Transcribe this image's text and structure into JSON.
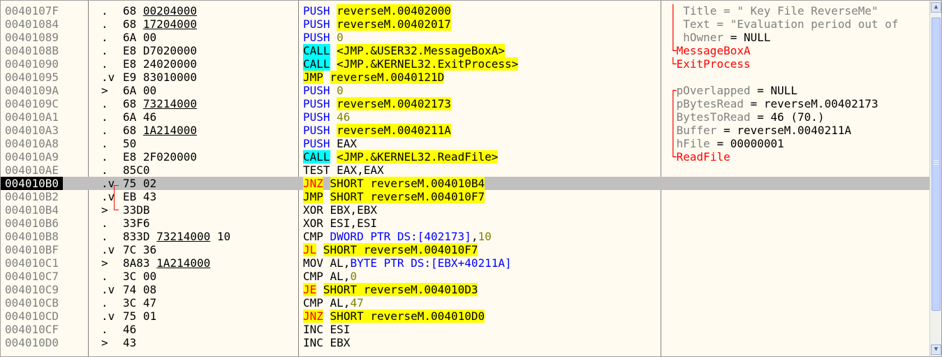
{
  "rows": [
    {
      "addr": "0040107F",
      "mark": ".",
      "hex": [
        {
          "t": "68 "
        },
        {
          "t": "00204000",
          "u": true
        }
      ],
      "dis": [
        {
          "t": "PUSH",
          "c": "kw-push"
        },
        {
          "t": " "
        },
        {
          "t": "reverseM.00402000",
          "c": "yl"
        }
      ],
      "cmt": [
        {
          "t": "│ ",
          "c": "cm-red"
        },
        {
          "t": "Title = \" Key File ReverseMe\"",
          "c": "cm-gray"
        }
      ]
    },
    {
      "addr": "00401084",
      "mark": ".",
      "hex": [
        {
          "t": "68 "
        },
        {
          "t": "17204000",
          "u": true
        }
      ],
      "dis": [
        {
          "t": "PUSH",
          "c": "kw-push"
        },
        {
          "t": " "
        },
        {
          "t": "reverseM.00402017",
          "c": "yl"
        }
      ],
      "cmt": [
        {
          "t": "│ ",
          "c": "cm-red"
        },
        {
          "t": "Text = \"Evaluation period out of",
          "c": "cm-gray"
        }
      ]
    },
    {
      "addr": "00401089",
      "mark": ".",
      "hex": [
        {
          "t": "6A 00"
        }
      ],
      "dis": [
        {
          "t": "PUSH",
          "c": "kw-push"
        },
        {
          "t": " "
        },
        {
          "t": "0",
          "c": "num"
        }
      ],
      "cmt": [
        {
          "t": "│ ",
          "c": "cm-red"
        },
        {
          "t": "hOwner",
          "c": "cm-gray"
        },
        {
          "t": " = NULL"
        }
      ]
    },
    {
      "addr": "0040108B",
      "mark": ".",
      "hex": [
        {
          "t": "E8 D7020000"
        }
      ],
      "dis": [
        {
          "t": "CALL",
          "c": "kw-call"
        },
        {
          "t": " "
        },
        {
          "t": "<JMP.&USER32.MessageBoxA>",
          "c": "yl"
        }
      ],
      "cmt": [
        {
          "t": "└",
          "c": "cm-red"
        },
        {
          "t": "MessageBoxA",
          "c": "cm-red"
        }
      ]
    },
    {
      "addr": "00401090",
      "mark": ".",
      "hex": [
        {
          "t": "E8 24020000"
        }
      ],
      "dis": [
        {
          "t": "CALL",
          "c": "kw-call"
        },
        {
          "t": " "
        },
        {
          "t": "<JMP.&KERNEL32.ExitProcess>",
          "c": "yl"
        }
      ],
      "cmt": [
        {
          "t": "└",
          "c": "cm-red"
        },
        {
          "t": "ExitProcess",
          "c": "cm-red"
        }
      ]
    },
    {
      "addr": "00401095",
      "mark": ".v",
      "hex": [
        {
          "t": "E9 83010000"
        }
      ],
      "dis": [
        {
          "t": "JMP",
          "c": "kw-jmp"
        },
        {
          "t": " "
        },
        {
          "t": "reverseM.0040121D",
          "c": "yl"
        }
      ],
      "cmt": []
    },
    {
      "addr": "0040109A",
      "mark": ">",
      "hex": [
        {
          "t": "6A 00"
        }
      ],
      "dis": [
        {
          "t": "PUSH",
          "c": "kw-push"
        },
        {
          "t": " "
        },
        {
          "t": "0",
          "c": "num"
        }
      ],
      "cmt": [
        {
          "t": "┌",
          "c": "cm-red"
        },
        {
          "t": "pOverlapped",
          "c": "cm-gray"
        },
        {
          "t": " = NULL"
        }
      ]
    },
    {
      "addr": "0040109C",
      "mark": ".",
      "hex": [
        {
          "t": "68 "
        },
        {
          "t": "73214000",
          "u": true
        }
      ],
      "dis": [
        {
          "t": "PUSH",
          "c": "kw-push"
        },
        {
          "t": " "
        },
        {
          "t": "reverseM.00402173",
          "c": "yl"
        }
      ],
      "cmt": [
        {
          "t": "│",
          "c": "cm-red"
        },
        {
          "t": "pBytesRead",
          "c": "cm-gray"
        },
        {
          "t": " = reverseM.00402173"
        }
      ]
    },
    {
      "addr": "004010A1",
      "mark": ".",
      "hex": [
        {
          "t": "6A 46"
        }
      ],
      "dis": [
        {
          "t": "PUSH",
          "c": "kw-push"
        },
        {
          "t": " "
        },
        {
          "t": "46",
          "c": "num"
        }
      ],
      "cmt": [
        {
          "t": "│",
          "c": "cm-red"
        },
        {
          "t": "BytesToRead",
          "c": "cm-gray"
        },
        {
          "t": " = 46 (70.)"
        }
      ]
    },
    {
      "addr": "004010A3",
      "mark": ".",
      "hex": [
        {
          "t": "68 "
        },
        {
          "t": "1A214000",
          "u": true
        }
      ],
      "dis": [
        {
          "t": "PUSH",
          "c": "kw-push"
        },
        {
          "t": " "
        },
        {
          "t": "reverseM.0040211A",
          "c": "yl"
        }
      ],
      "cmt": [
        {
          "t": "│",
          "c": "cm-red"
        },
        {
          "t": "Buffer",
          "c": "cm-gray"
        },
        {
          "t": " = reverseM.0040211A"
        }
      ]
    },
    {
      "addr": "004010A8",
      "mark": ".",
      "hex": [
        {
          "t": "50"
        }
      ],
      "dis": [
        {
          "t": "PUSH",
          "c": "kw-push"
        },
        {
          "t": " EAX"
        }
      ],
      "cmt": [
        {
          "t": "│",
          "c": "cm-red"
        },
        {
          "t": "hFile",
          "c": "cm-gray"
        },
        {
          "t": " = 00000001"
        }
      ]
    },
    {
      "addr": "004010A9",
      "mark": ".",
      "hex": [
        {
          "t": "E8 2F020000"
        }
      ],
      "dis": [
        {
          "t": "CALL",
          "c": "kw-call"
        },
        {
          "t": " "
        },
        {
          "t": "<JMP.&KERNEL32.ReadFile>",
          "c": "yl"
        }
      ],
      "cmt": [
        {
          "t": "└",
          "c": "cm-red"
        },
        {
          "t": "ReadFile",
          "c": "cm-red"
        }
      ]
    },
    {
      "addr": "004010AE",
      "mark": ".",
      "hex": [
        {
          "t": "85C0"
        }
      ],
      "dis": [
        {
          "t": "TEST EAX,EAX"
        }
      ],
      "cmt": []
    },
    {
      "addr": "004010B0",
      "mark": ".v",
      "hex": [
        {
          "t": "75 02"
        }
      ],
      "dis": [
        {
          "t": "JNZ",
          "c": "kw-jcc"
        },
        {
          "t": " "
        },
        {
          "t": "SHORT reverseM.004010B4",
          "c": "yl"
        }
      ],
      "cmt": [],
      "sel": true
    },
    {
      "addr": "004010B2",
      "mark": ".v",
      "hex": [
        {
          "t": "EB 43"
        }
      ],
      "dis": [
        {
          "t": "JMP",
          "c": "kw-jmp"
        },
        {
          "t": " "
        },
        {
          "t": "SHORT reverseM.004010F7",
          "c": "yl"
        }
      ],
      "cmt": []
    },
    {
      "addr": "004010B4",
      "mark": ">",
      "hex": [
        {
          "t": "33DB"
        }
      ],
      "dis": [
        {
          "t": "XOR EBX,EBX"
        }
      ],
      "cmt": []
    },
    {
      "addr": "004010B6",
      "mark": ".",
      "hex": [
        {
          "t": "33F6"
        }
      ],
      "dis": [
        {
          "t": "XOR ESI,ESI"
        }
      ],
      "cmt": []
    },
    {
      "addr": "004010B8",
      "mark": ".",
      "hex": [
        {
          "t": "833D "
        },
        {
          "t": "73214000",
          "u": true
        },
        {
          "t": " 10"
        }
      ],
      "dis": [
        {
          "t": "CMP "
        },
        {
          "t": "DWORD PTR DS:[402173]",
          "c": "m-blue"
        },
        {
          "t": ","
        },
        {
          "t": "10",
          "c": "num"
        }
      ],
      "cmt": []
    },
    {
      "addr": "004010BF",
      "mark": ".v",
      "hex": [
        {
          "t": "7C 36"
        }
      ],
      "dis": [
        {
          "t": "JL",
          "c": "kw-jcc"
        },
        {
          "t": " "
        },
        {
          "t": "SHORT reverseM.004010F7",
          "c": "yl"
        }
      ],
      "cmt": []
    },
    {
      "addr": "004010C1",
      "mark": ">",
      "hex": [
        {
          "t": "8A83 "
        },
        {
          "t": "1A214000",
          "u": true
        }
      ],
      "dis": [
        {
          "t": "MOV AL,"
        },
        {
          "t": "BYTE PTR DS:[EBX+40211A]",
          "c": "m-blue"
        }
      ],
      "cmt": []
    },
    {
      "addr": "004010C7",
      "mark": ".",
      "hex": [
        {
          "t": "3C 00"
        }
      ],
      "dis": [
        {
          "t": "CMP AL,"
        },
        {
          "t": "0",
          "c": "num"
        }
      ],
      "cmt": []
    },
    {
      "addr": "004010C9",
      "mark": ".v",
      "hex": [
        {
          "t": "74 08"
        }
      ],
      "dis": [
        {
          "t": "JE",
          "c": "kw-jcc"
        },
        {
          "t": " "
        },
        {
          "t": "SHORT reverseM.004010D3",
          "c": "yl"
        }
      ],
      "cmt": []
    },
    {
      "addr": "004010CB",
      "mark": ".",
      "hex": [
        {
          "t": "3C 47"
        }
      ],
      "dis": [
        {
          "t": "CMP AL,"
        },
        {
          "t": "47",
          "c": "num"
        }
      ],
      "cmt": []
    },
    {
      "addr": "004010CD",
      "mark": ".v",
      "hex": [
        {
          "t": "75 01"
        }
      ],
      "dis": [
        {
          "t": "JNZ",
          "c": "kw-jcc"
        },
        {
          "t": " "
        },
        {
          "t": "SHORT reverseM.004010D0",
          "c": "yl"
        }
      ],
      "cmt": []
    },
    {
      "addr": "004010CF",
      "mark": ".",
      "hex": [
        {
          "t": "46"
        }
      ],
      "dis": [
        {
          "t": "INC ESI"
        }
      ],
      "cmt": []
    },
    {
      "addr": "004010D0",
      "mark": ">",
      "hex": [
        {
          "t": "43"
        }
      ],
      "dis": [
        {
          "t": "INC EBX"
        }
      ],
      "cmt": []
    }
  ],
  "scrollbar": {
    "up_icon": "▲",
    "down_icon": "▼"
  }
}
